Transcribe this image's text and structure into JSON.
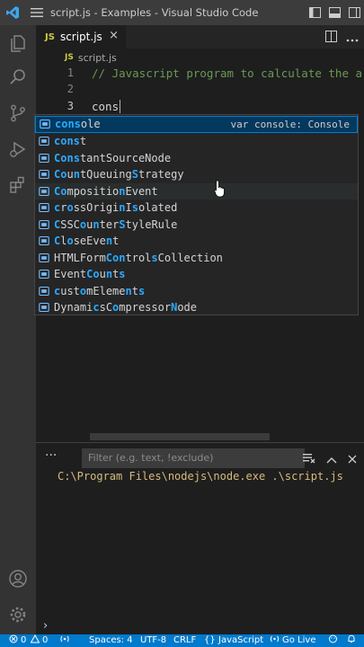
{
  "window": {
    "title": "script.js - Examples - Visual Studio Code"
  },
  "tab": {
    "file_badge": "JS",
    "file_name": "script.js",
    "close_glyph": "×"
  },
  "breadcrumb": {
    "file_badge": "JS",
    "file_name": "script.js"
  },
  "editor": {
    "lines": [
      {
        "number": "1",
        "text": "// Javascript program to calculate the are"
      },
      {
        "number": "2",
        "text": ""
      },
      {
        "number": "3",
        "text": "cons"
      }
    ]
  },
  "suggestions": {
    "detail": "var console: Console",
    "items": [
      {
        "match": "cons",
        "rest": "ole"
      },
      {
        "match": "cons",
        "rest": "t"
      },
      {
        "label": "ConstantSourceNode"
      },
      {
        "label": "CountQueuingStrategy"
      },
      {
        "label": "CompositionEvent"
      },
      {
        "label": "crossOriginIsolated"
      },
      {
        "label": "CSSCounterStyleRule"
      },
      {
        "label": "CloseEvent"
      },
      {
        "label": "HTMLFormControlsCollection"
      },
      {
        "label": "EventCounts"
      },
      {
        "label": "customElements"
      },
      {
        "label": "DynamicsCompressorNode"
      }
    ]
  },
  "panel": {
    "more": "···",
    "filter_placeholder": "Filter (e.g. text, !exclude)",
    "output": "C:\\Program Files\\nodejs\\node.exe .\\script.js",
    "prompt": "›"
  },
  "statusbar": {
    "errors": "0",
    "warnings": "0",
    "spaces": "Spaces: 4",
    "encoding": "UTF-8",
    "eol": "CRLF",
    "language_braces": "{}",
    "language": "JavaScript",
    "go_live": "Go Live"
  },
  "colors": {
    "accent": "#007acc",
    "match": "#2aaaff",
    "comment": "#6a9955",
    "output": "#d7ba7d",
    "js_badge": "#cbcb41"
  },
  "icons": [
    "vscode-logo-icon",
    "menu-icon",
    "layout-sidebar-icon",
    "layout-panel-icon",
    "layout-secondary-icon",
    "explorer-icon",
    "search-icon",
    "source-control-icon",
    "run-debug-icon",
    "extensions-icon",
    "account-icon",
    "manage-gear-icon",
    "split-editor-icon",
    "more-actions-icon",
    "variable-icon",
    "clear-output-icon",
    "chevron-up-icon",
    "close-icon",
    "error-icon",
    "warning-icon",
    "broadcast-icon",
    "bell-icon",
    "feedback-icon"
  ]
}
